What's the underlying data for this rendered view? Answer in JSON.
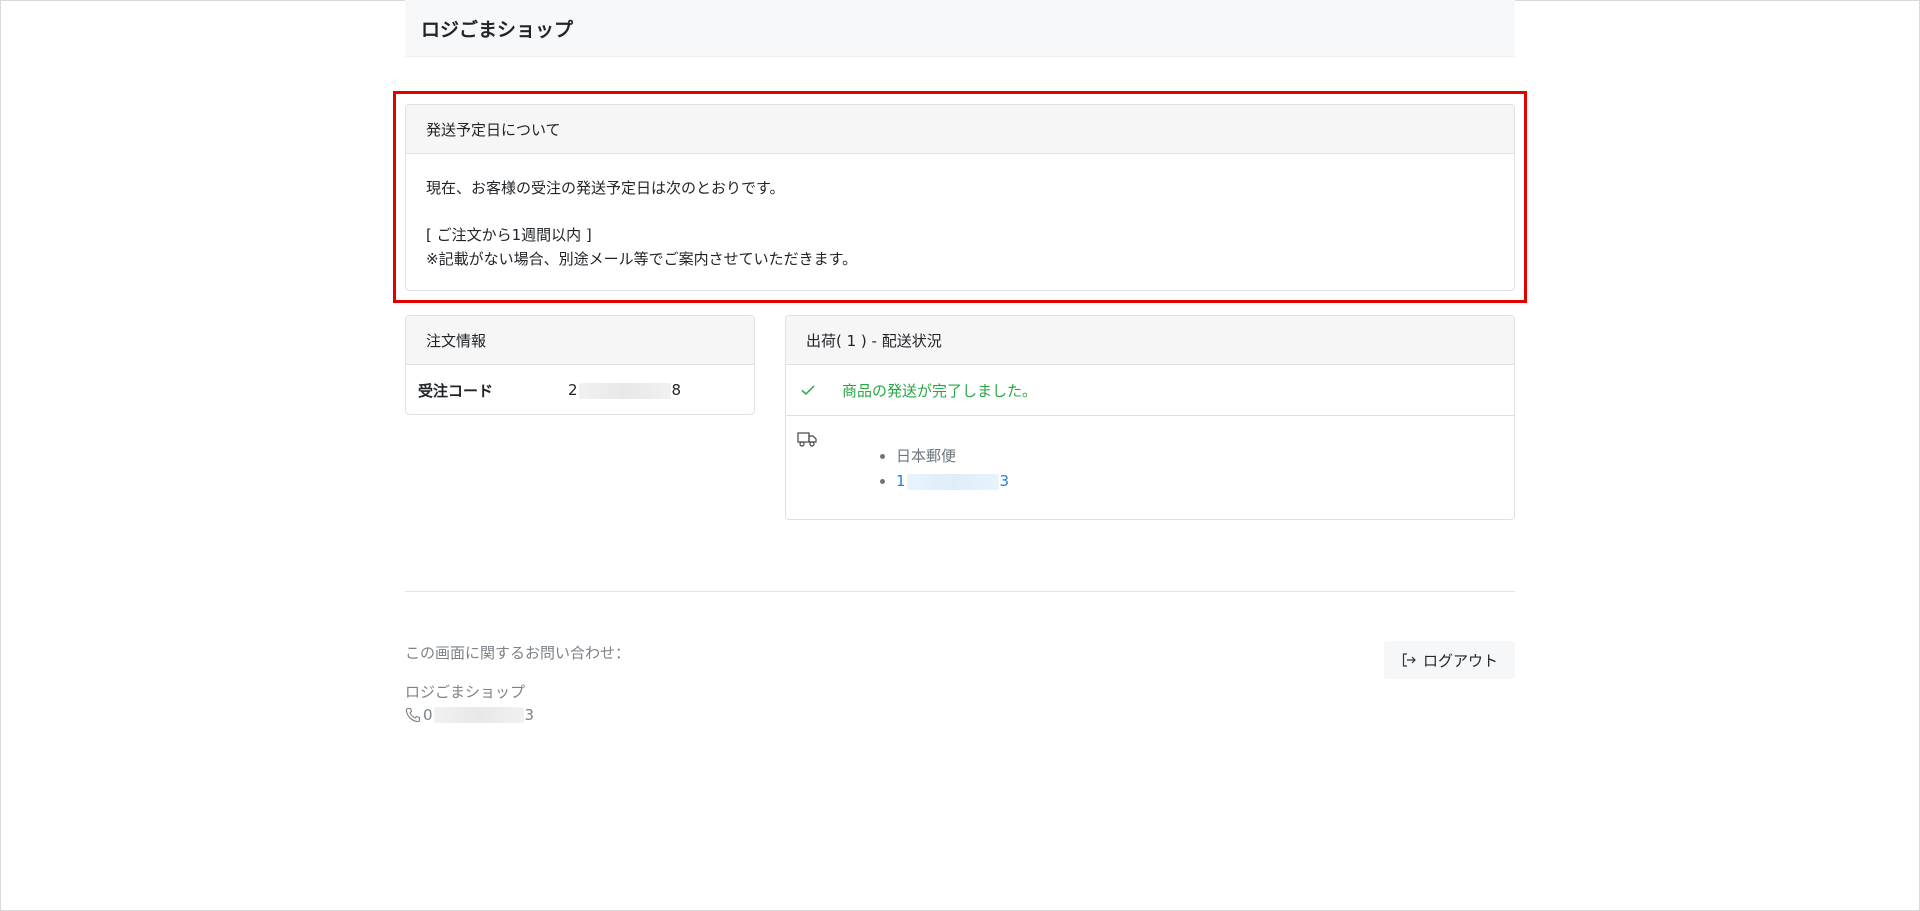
{
  "header": {
    "shop_name": "ロジごまショップ"
  },
  "notice": {
    "title": "発送予定日について",
    "line1": "現在、お客様の受注の発送予定日は次のとおりです。",
    "line2": "[ ご注文から1週間以内 ]",
    "line3": "※記載がない場合、別途メール等でご案内させていただきます。"
  },
  "order": {
    "title": "注文情報",
    "code_label": "受注コード",
    "code_prefix": "2",
    "code_suffix": "8"
  },
  "shipment": {
    "title": "出荷( 1 ) - 配送状況",
    "status": "商品の発送が完了しました。",
    "carrier": "日本郵便",
    "tracking_prefix": "1",
    "tracking_suffix": "3"
  },
  "footer": {
    "contact_title": "この画面に関するお問い合わせ：",
    "shop_name": "ロジごまショップ",
    "phone_prefix": "0",
    "phone_suffix": "3",
    "logout_label": "ログアウト"
  },
  "colors": {
    "status_green": "#28a745",
    "link_blue": "#2b7fd4",
    "highlight_red": "#e50000"
  },
  "icons": [
    "check-icon",
    "truck-icon",
    "phone-icon",
    "logout-icon"
  ]
}
